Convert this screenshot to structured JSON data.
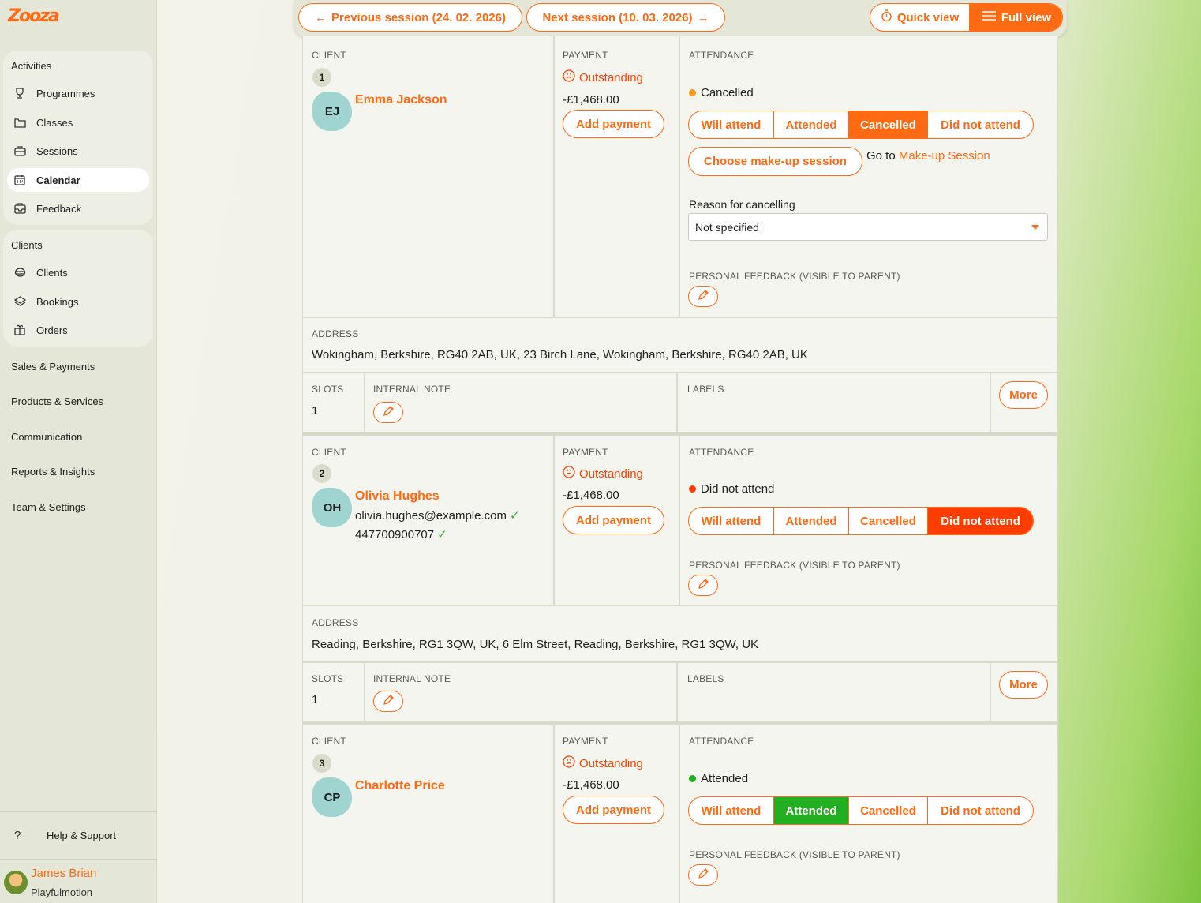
{
  "app": {
    "logo_text": "Zooza"
  },
  "sidebar": {
    "activities_title": "Activities",
    "activities": [
      {
        "label": "Programmes",
        "icon": "trophy-icon"
      },
      {
        "label": "Classes",
        "icon": "folder-icon"
      },
      {
        "label": "Sessions",
        "icon": "briefcase-icon"
      },
      {
        "label": "Calendar",
        "icon": "calendar-icon",
        "active": true
      },
      {
        "label": "Feedback",
        "icon": "inbox-icon"
      }
    ],
    "clients_title": "Clients",
    "clients": [
      {
        "label": "Clients",
        "icon": "users-icon"
      },
      {
        "label": "Bookings",
        "icon": "layers-icon"
      },
      {
        "label": "Orders",
        "icon": "gift-icon"
      }
    ],
    "top_items": [
      "Sales & Payments",
      "Products & Services",
      "Communication",
      "Reports & Insights",
      "Team & Settings"
    ],
    "help": "Help & Support",
    "user": {
      "name": "James Brian",
      "org": "Playfulmotion"
    }
  },
  "topbar": {
    "previous": "Previous session (24. 02. 2026)",
    "next": "Next session (10. 03. 2026)",
    "quick_view": "Quick view",
    "full_view": "Full view"
  },
  "labels": {
    "client": "CLIENT",
    "payment": "PAYMENT",
    "attendance": "ATTENDANCE",
    "address": "ADDRESS",
    "slots": "SLOTS",
    "internal_note": "INTERNAL NOTE",
    "labels": "LABELS",
    "more": "More",
    "add_payment": "Add payment",
    "outstanding": "Outstanding",
    "personal_feedback": "PERSONAL FEEDBACK (VISIBLE TO PARENT)",
    "opt_will_attend": "Will attend",
    "opt_attended": "Attended",
    "opt_cancelled": "Cancelled",
    "opt_did_not_attend": "Did not attend",
    "choose_makeup": "Choose make-up session",
    "goto_prefix": "Go to",
    "makeup_link": "Make-up Session",
    "reason_label": "Reason for cancelling",
    "reason_value": "Not specified"
  },
  "clients": [
    {
      "index": "1",
      "initials": "EJ",
      "name": "Emma Jackson",
      "amount": "-£1,468.00",
      "status": "Cancelled",
      "status_color": "#f39a1c",
      "address": "Wokingham, Berkshire, RG40 2AB, UK, 23 Birch Lane, Wokingham, Berkshire, RG40 2AB, UK",
      "slots": "1"
    },
    {
      "index": "2",
      "initials": "OH",
      "name": "Olivia Hughes",
      "email": "olivia.hughes@example.com",
      "phone": "447700900707",
      "amount": "-£1,468.00",
      "status": "Did not attend",
      "status_color": "#ff3d00",
      "address": "Reading, Berkshire, RG1 3QW, UK, 6 Elm Street, Reading, Berkshire, RG1 3QW, UK",
      "slots": "1"
    },
    {
      "index": "3",
      "initials": "CP",
      "name": "Charlotte Price",
      "amount": "-£1,468.00",
      "status": "Attended",
      "status_color": "#22b022"
    }
  ]
}
